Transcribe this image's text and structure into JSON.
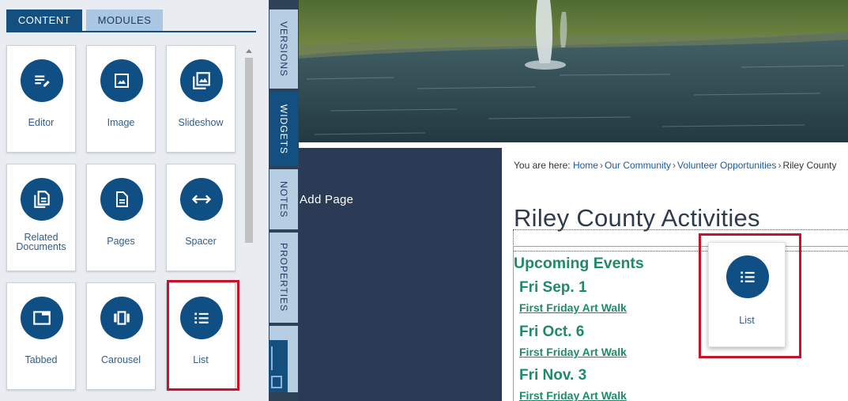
{
  "panel": {
    "tabs": [
      {
        "label": "CONTENT",
        "active": true
      },
      {
        "label": "MODULES",
        "active": false
      }
    ],
    "widgets": [
      {
        "label": "Editor",
        "icon": "editor-icon"
      },
      {
        "label": "Image",
        "icon": "image-icon"
      },
      {
        "label": "Slideshow",
        "icon": "slideshow-icon"
      },
      {
        "label_line1": "Related",
        "label_line2": "Documents",
        "icon": "related-documents-icon"
      },
      {
        "label": "Pages",
        "icon": "pages-icon"
      },
      {
        "label": "Spacer",
        "icon": "spacer-icon"
      },
      {
        "label": "Tabbed",
        "icon": "tabbed-icon"
      },
      {
        "label": "Carousel",
        "icon": "carousel-icon"
      },
      {
        "label": "List",
        "icon": "list-icon"
      }
    ]
  },
  "side_tabs": [
    {
      "label": "VERSIONS",
      "active": false
    },
    {
      "label": "WIDGETS",
      "active": true
    },
    {
      "label": "NOTES",
      "active": false
    },
    {
      "label": "PROPERTIES",
      "active": false
    }
  ],
  "nav": {
    "add_page": "Add Page"
  },
  "page": {
    "breadcrumb_prefix": "You are here:",
    "breadcrumb": [
      "Home",
      "Our Community",
      "Volunteer Opportunities"
    ],
    "breadcrumb_current": "Riley County",
    "title": "Riley County Activities",
    "events_heading": "Upcoming Events",
    "events": [
      {
        "date": "Fri Sep. 1",
        "link": "First Friday Art Walk"
      },
      {
        "date": "Fri Oct. 6",
        "link": "First Friday Art Walk"
      },
      {
        "date": "Fri Nov. 3",
        "link": "First Friday Art Walk"
      }
    ]
  },
  "drag_card": {
    "label": "List",
    "icon": "list-icon"
  },
  "colors": {
    "accent": "#14507f",
    "highlight": "#c4142b",
    "event_green": "#1f8a6b",
    "nav_dark": "#2b3a55"
  }
}
